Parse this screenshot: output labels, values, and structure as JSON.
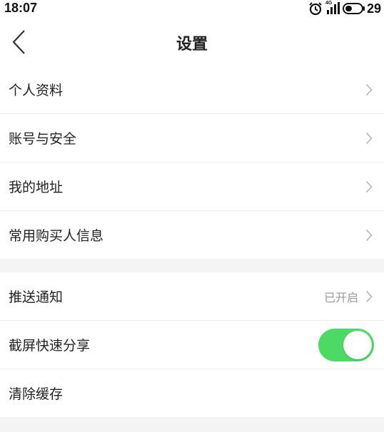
{
  "status_bar": {
    "time": "18:07",
    "network": "4G",
    "battery": "29",
    "icons": [
      "alarm-icon",
      "signal-icon",
      "battery-icon"
    ]
  },
  "header": {
    "title": "设置",
    "back_icon": "chevron-left-icon"
  },
  "groups": [
    {
      "items": [
        {
          "label": "个人资料",
          "icon": "chevron-right-icon"
        },
        {
          "label": "账号与安全",
          "icon": "chevron-right-icon"
        },
        {
          "label": "我的地址",
          "icon": "chevron-right-icon"
        },
        {
          "label": "常用购买人信息",
          "icon": "chevron-right-icon"
        }
      ]
    },
    {
      "items": [
        {
          "label": "推送通知",
          "value": "已开启",
          "icon": "chevron-right-icon"
        },
        {
          "label": "截屏快速分享",
          "toggle": true
        },
        {
          "label": "清除缓存"
        }
      ]
    }
  ],
  "colors": {
    "toggle_on": "#4cd964",
    "background": "#f4f4f4",
    "secondary_text": "#999999"
  }
}
